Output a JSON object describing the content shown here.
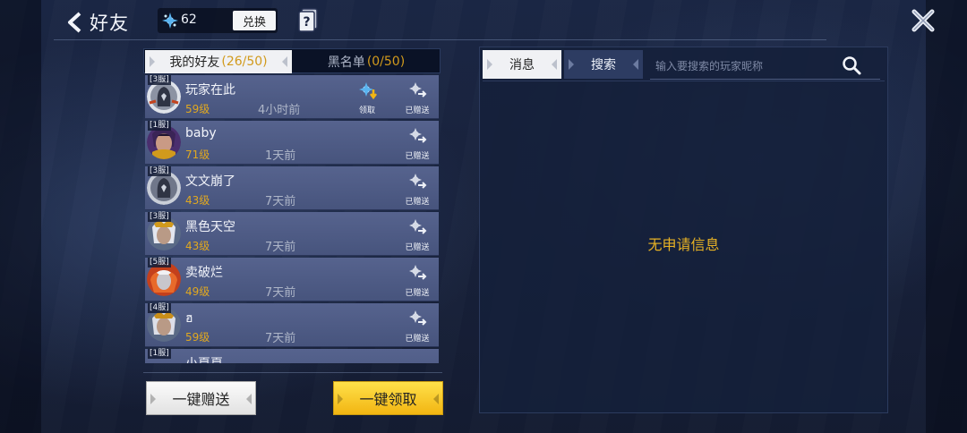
{
  "header": {
    "title": "好友",
    "currency_value": "62",
    "exchange_label": "兑换"
  },
  "friends_panel": {
    "tabs": {
      "friends_label": "我的好友",
      "friends_count": "(26/50)",
      "blacklist_label": "黑名单",
      "blacklist_count": "(0/50)"
    },
    "rows": [
      {
        "server": "[3服]",
        "name": "玩家在此",
        "level": "59级",
        "time": "4小时前",
        "claim_label": "领取",
        "sent_label": "已赠送"
      },
      {
        "server": "[1服]",
        "name": "baby",
        "level": "71级",
        "time": "1天前",
        "sent_label": "已赠送"
      },
      {
        "server": "[3服]",
        "name": "文文崩了",
        "level": "43级",
        "time": "7天前",
        "sent_label": "已赠送"
      },
      {
        "server": "[3服]",
        "name": "黑色天空",
        "level": "43级",
        "time": "7天前",
        "sent_label": "已赠送"
      },
      {
        "server": "[5服]",
        "name": "卖破烂",
        "level": "49级",
        "time": "7天前",
        "sent_label": "已赠送"
      },
      {
        "server": "[4服]",
        "name": "ฮ",
        "level": "59级",
        "time": "7天前",
        "sent_label": "已赠送"
      },
      {
        "server": "[1服]",
        "name": "小夏夏"
      }
    ],
    "send_all_label": "一键赠送",
    "claim_all_label": "一键领取"
  },
  "message_panel": {
    "tab_message": "消息",
    "tab_search": "搜索",
    "search_placeholder": "输入要搜索的玩家昵称",
    "empty_text": "无申请信息"
  },
  "colors": {
    "accent_gold": "#e0a820",
    "row_bg": "#4f5c86",
    "claim_button": "#f5c21f"
  }
}
